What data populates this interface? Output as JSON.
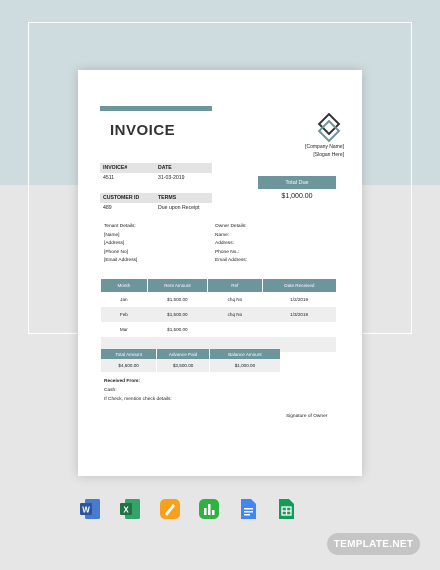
{
  "invoice": {
    "title": "INVOICE",
    "company_name": "[Company Name]",
    "slogan": "[Slogan Here]",
    "invoice_label": "INVOICE#",
    "date_label": "DATE",
    "invoice_number": "4511",
    "date": "31-03-2019",
    "customer_label": "CUSTOMER ID",
    "terms_label": "TERMS",
    "customer_id": "489",
    "terms": "Due upon Receipt",
    "total_due_label": "Total Due",
    "total_due": "$1,000.00"
  },
  "tenant": {
    "heading": "Tenant Details:",
    "lines": [
      "[Name]",
      "[Address]",
      "[Phone No]",
      "[Email Address]"
    ]
  },
  "owner": {
    "heading": "Owner Details:",
    "lines": [
      "Name:",
      "Address:",
      "Phone No.:",
      "Email Address:"
    ]
  },
  "rent_table": {
    "headers": [
      "Month",
      "Rent Amount",
      "Ref",
      "Date Received"
    ],
    "rows": [
      [
        "Jan",
        "$1,500.00",
        "chq No",
        "1/2/2019"
      ],
      [
        "Feb",
        "$1,500.00",
        "chq No",
        "1/3/2019"
      ],
      [
        "Mar",
        "$1,500.00",
        "",
        ""
      ]
    ]
  },
  "totals_table": {
    "headers": [
      "Total Amount",
      "Advance Paid",
      "Balance Amount"
    ],
    "values": [
      "$4,500.00",
      "$3,500.00",
      "$1,000.00"
    ]
  },
  "received": {
    "heading": "Received From:",
    "cash": "Cash:",
    "check": "If Check, mention check details:"
  },
  "signature": "Signature of Owner",
  "apps": [
    "word-icon",
    "excel-icon",
    "pages-icon",
    "numbers-icon",
    "google-docs-icon",
    "google-sheets-icon"
  ],
  "brand": "TEMPLATE.NET",
  "colors": {
    "accent": "#6c959c",
    "background_top": "#cfdcdf",
    "background_bottom": "#e6e6e6"
  }
}
